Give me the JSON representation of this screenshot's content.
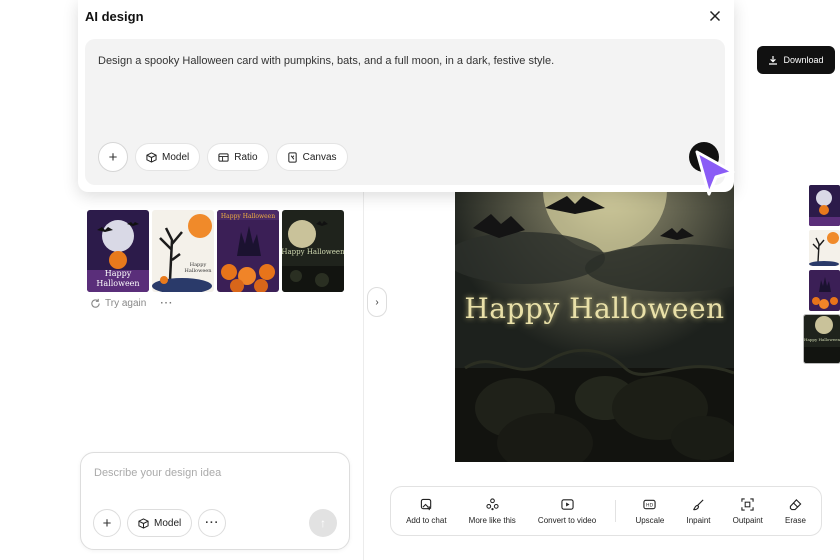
{
  "modal": {
    "title": "AI design",
    "prompt": "Design a spooky Halloween card with pumpkins, bats, and a full moon, in a dark, festive style.",
    "tools": {
      "model": "Model",
      "ratio": "Ratio",
      "canvas": "Canvas"
    }
  },
  "history": {
    "thumb2_text": "Happy\nHalloween",
    "retry_label": "Try again"
  },
  "chat": {
    "placeholder": "Describe your design idea",
    "model_label": "Model"
  },
  "canvas": {
    "image_title": "Happy Halloween",
    "download_label": "Download"
  },
  "toolbar": {
    "add_to_chat": "Add to chat",
    "more_like_this": "More like this",
    "convert_to_video": "Convert to video",
    "upscale": "Upscale",
    "inpaint": "Inpaint",
    "outpaint": "Outpaint",
    "erase": "Erase"
  },
  "colors": {
    "accent_purple": "#8a5cf6",
    "dark_button": "#111111"
  }
}
